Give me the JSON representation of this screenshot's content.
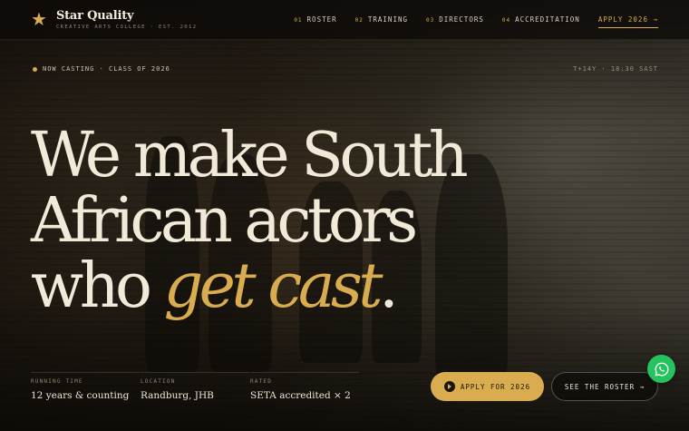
{
  "brand": {
    "name": "Star Quality",
    "tagline": "CREATIVE ARTS COLLEGE · EST. 2012",
    "logo_icon": "star-icon",
    "accent_color": "#d9ac4f"
  },
  "nav": {
    "items": [
      {
        "num": "01",
        "label": "ROSTER"
      },
      {
        "num": "02",
        "label": "TRAINING"
      },
      {
        "num": "03",
        "label": "DIRECTORS"
      },
      {
        "num": "04",
        "label": "ACCREDITATION"
      }
    ],
    "apply_label": "APPLY 2026 →"
  },
  "status": {
    "text": "NOW CASTING · CLASS OF 2026",
    "clock": "T+14Y · 18:30 SAST"
  },
  "headline": {
    "line1": "We make South",
    "line2": "African actors",
    "line3_prefix": "who ",
    "line3_highlight": "get cast",
    "line3_suffix": "."
  },
  "stats": [
    {
      "label": "RUNNING TIME",
      "value": "12 years & counting"
    },
    {
      "label": "LOCATION",
      "value": "Randburg, JHB"
    },
    {
      "label": "RATED",
      "value": "SETA accredited × 2"
    }
  ],
  "cta": {
    "primary": "APPLY FOR 2026",
    "secondary": "SEE THE ROSTER →"
  },
  "chat": {
    "icon": "whatsapp-icon",
    "color": "#25c35f"
  }
}
